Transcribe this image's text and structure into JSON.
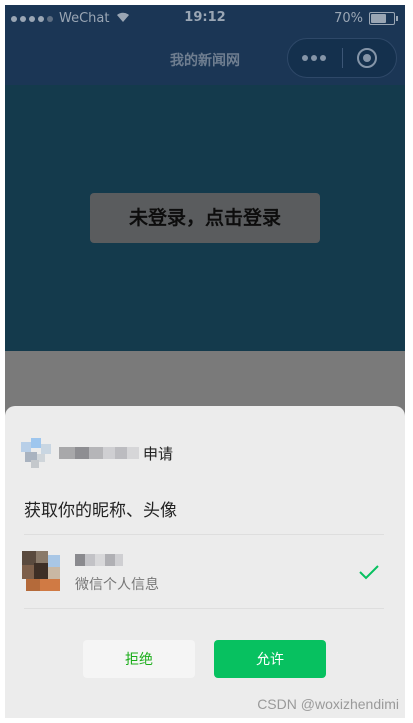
{
  "status_bar": {
    "carrier": "WeChat",
    "time": "19:12",
    "battery": "70%",
    "battery_level": 0.7
  },
  "nav": {
    "title": "我的新闻网"
  },
  "page": {
    "login_button": "未登录，点击登录"
  },
  "auth_sheet": {
    "request_suffix": "申请",
    "scope": "获取你的昵称、头像",
    "user_info_desc": "微信个人信息",
    "reject_label": "拒绝",
    "allow_label": "允许"
  },
  "colors": {
    "allow_green": "#07c160",
    "check_green": "#07c160"
  },
  "watermark": "CSDN @woxizhendimi"
}
